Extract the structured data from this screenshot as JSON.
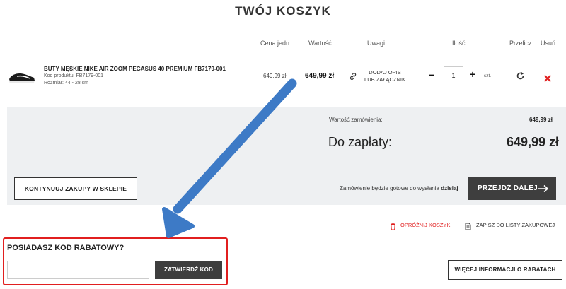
{
  "page": {
    "title": "TWÓJ KOSZYK"
  },
  "table_headers": {
    "unit_price": "Cena jedn.",
    "value": "Wartość",
    "notes": "Uwagi",
    "quantity": "Ilość",
    "recalculate": "Przelicz",
    "remove": "Usuń"
  },
  "item": {
    "name": "BUTY MĘSKIE NIKE AIR ZOOM PEGASUS 40 PREMIUM FB7179-001",
    "code": "Kod produktu: FB7179-001",
    "size": "Rozmiar: 44 - 28 cm",
    "unit_price": "649,99 zł",
    "value": "649,99 zł",
    "note_line1": "DODAJ OPIS",
    "note_line2": "LUB ZAŁĄCZNIK",
    "quantity": "1",
    "unit": "szt."
  },
  "summary": {
    "order_value_label": "Wartość zamówienia:",
    "order_value": "649,99 zł",
    "to_pay_label": "Do zapłaty:",
    "to_pay": "649,99 zł"
  },
  "actions": {
    "continue_shopping": "KONTYNUUJ ZAKUPY W SKLEPIE",
    "ready_text": "Zamówienie będzie gotowe do wysłania",
    "ready_when": "dzisiaj",
    "proceed": "PRZEJDŹ DALEJ",
    "empty_cart": "OPRÓŻNIJ KOSZYK",
    "save_list": "ZAPISZ DO LISTY ZAKUPOWEJ"
  },
  "promo": {
    "title": "POSIADASZ KOD RABATOWY?",
    "input_value": "",
    "submit": "ZATWIERDŹ KOD",
    "more_info": "WIĘCEJ INFORMACJI O RABATACH"
  },
  "colors": {
    "accent_red": "#e11f1f",
    "dark_button": "#3e3e3e",
    "arrow_blue": "#3d7ac6"
  }
}
